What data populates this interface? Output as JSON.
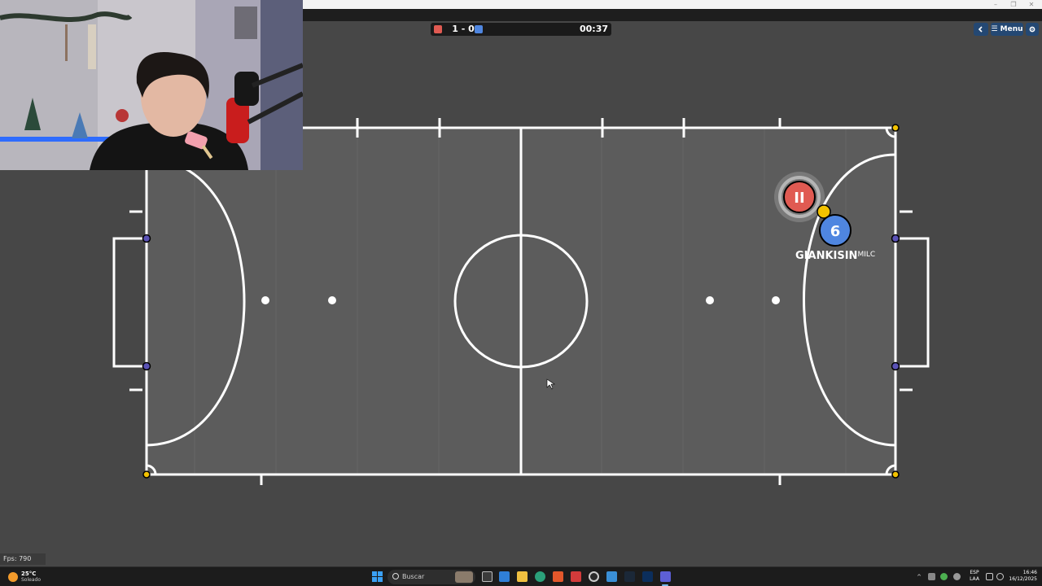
{
  "window": {
    "minimize_glyph": "–",
    "restore_glyph": "❐",
    "close_glyph": "✕"
  },
  "scoreboard": {
    "red_color": "#e05a52",
    "blue_color": "#4f86e0",
    "score": "1 - 0",
    "red_score": 1,
    "blue_score": 0,
    "timer": "00:37"
  },
  "topbar": {
    "back_icon": "arrow-left-icon",
    "menu_label": "☰ Menu",
    "settings_icon": "gear-icon"
  },
  "field": {
    "background": "#5b5b5b",
    "line_color": "#ffffff",
    "post_color_top": "#f2c200",
    "post_color_goal": "#5a52b5"
  },
  "players": {
    "red": {
      "avatar_text": "II",
      "color": "#e05a52"
    },
    "blue": {
      "avatar_text": "6",
      "color": "#4f86e0",
      "name": "GIANKISIN",
      "name_suffix": "MILC"
    },
    "ball_color": "#f2c200"
  },
  "webcam": {
    "description_icon": "streamer-webcam"
  },
  "fps": {
    "label": "Fps: 790"
  },
  "taskbar": {
    "weather_temp": "25°C",
    "weather_desc": "Soleado",
    "search_label": "Buscar",
    "lang_line1": "ESP",
    "lang_line2": "LAA",
    "time": "16:46",
    "date": "16/12/2025",
    "tray_chevron": "^"
  }
}
